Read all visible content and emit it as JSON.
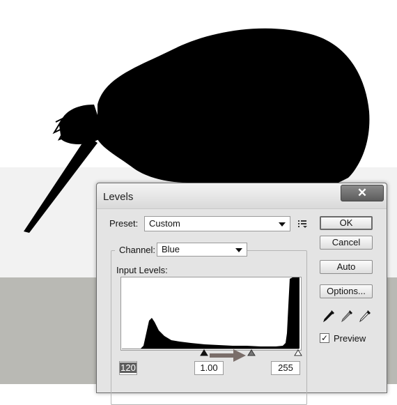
{
  "window": {
    "title": "Levels",
    "close_glyph": "✕"
  },
  "preset": {
    "label": "Preset:",
    "value": "Custom",
    "menu_icon": "preset-options-icon"
  },
  "channel": {
    "label": "Channel:",
    "value": "Blue"
  },
  "input_levels": {
    "label": "Input Levels:",
    "black_point": "120",
    "midtone": "1.00",
    "white_point": "255"
  },
  "buttons": {
    "ok": "OK",
    "cancel": "Cancel",
    "auto": "Auto",
    "options": "Options..."
  },
  "eyedroppers": [
    "black-eyedropper-icon",
    "gray-eyedropper-icon",
    "white-eyedropper-icon"
  ],
  "preview": {
    "label": "Preview",
    "checked": true
  },
  "colors": {
    "dialog_bg": "#e4e4e4",
    "histogram": "#000000",
    "annotation_arrow": "#7a6e6a"
  }
}
